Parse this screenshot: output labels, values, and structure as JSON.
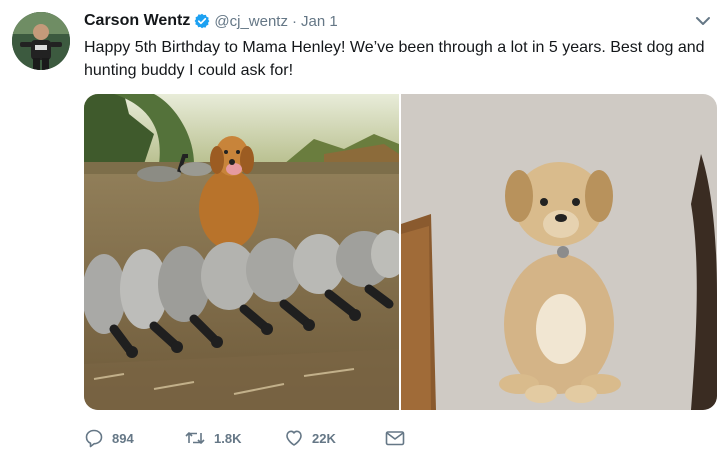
{
  "author": {
    "name": "Carson Wentz",
    "handle": "@cj_wentz",
    "separator": "·",
    "time": "Jan 1"
  },
  "tweet": {
    "text": "Happy 5th Birthday to Mama Henley! We’ve been through a lot in 5 years. Best dog and hunting buddy I could ask for!"
  },
  "media": {
    "photos": [
      {
        "subject": "golden retriever sitting behind a row of harvested geese in a field"
      },
      {
        "subject": "golden retriever puppy sitting on carpet"
      }
    ]
  },
  "actions": {
    "replies": "894",
    "retweets": "1.8K",
    "likes": "22K"
  },
  "icons": [
    "verified-badge-icon",
    "caret-down-icon",
    "reply-icon",
    "retweet-icon",
    "like-icon",
    "message-icon"
  ],
  "colors": {
    "verified": "#1da1f2",
    "muted": "#657786",
    "text": "#14171a"
  }
}
